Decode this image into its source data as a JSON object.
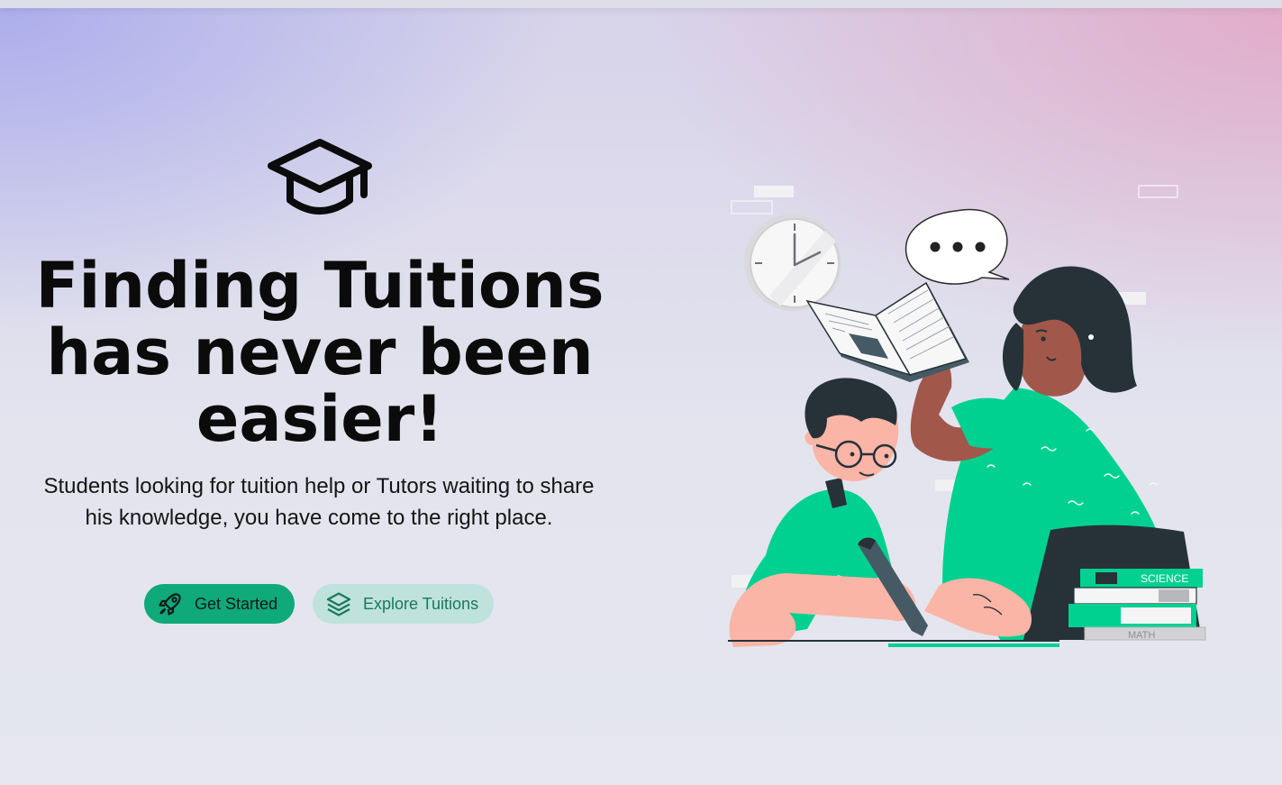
{
  "hero": {
    "icon": "graduation-cap-icon",
    "title": "Finding Tuitions has never been easier!",
    "subtitle": "Students looking for tuition help or Tutors waiting to share his knowledge, you have come to the right place.",
    "primary_button": {
      "label": "Get Started",
      "icon": "rocket-icon"
    },
    "secondary_button": {
      "label": "Explore Tuitions",
      "icon": "layers-icon"
    }
  },
  "illustration": {
    "book_labels": [
      "SCIENCE",
      "MATH"
    ],
    "accent_color": "#00d190"
  },
  "colors": {
    "primary_button": "#0fa97a",
    "secondary_button": "#bfe2dc",
    "secondary_text": "#177a5b"
  }
}
